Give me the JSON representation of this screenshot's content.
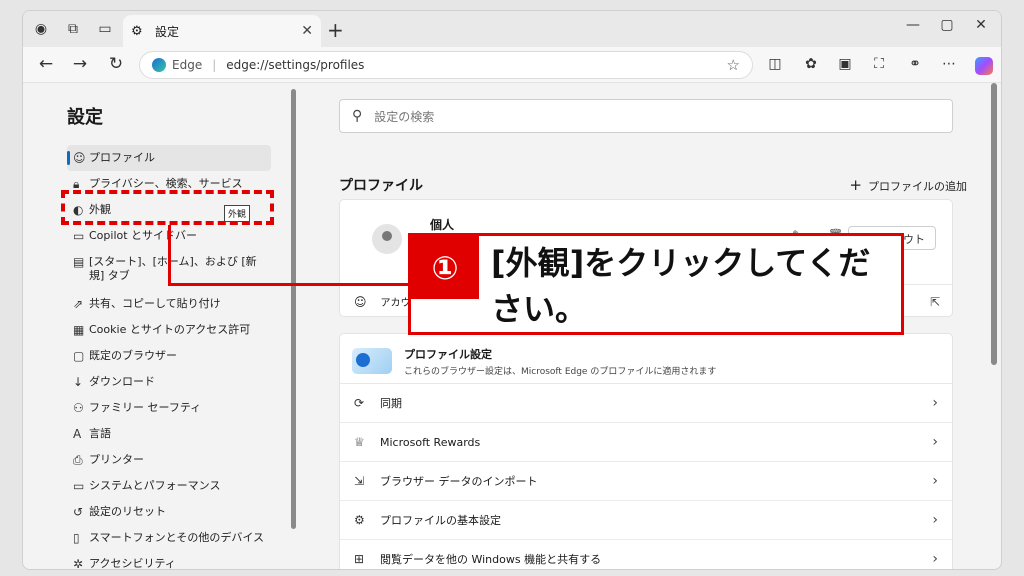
{
  "browser": {
    "tab_title": "設定",
    "address_brand": "Edge",
    "url": "edge://settings/profiles",
    "icons": [
      "profile-icon",
      "workspaces-icon",
      "tab-actions-icon",
      "gear-icon",
      "close-icon",
      "new-tab-icon",
      "back-icon",
      "forward-icon",
      "refresh-icon",
      "star-icon",
      "split-screen-icon",
      "extensions-icon",
      "collections-icon",
      "screenshot-icon",
      "share-icon",
      "more-icon",
      "copilot-icon"
    ]
  },
  "sidebar": {
    "title": "設定",
    "items": [
      {
        "label": "プロファイル",
        "icon": "profile-icon",
        "active": true
      },
      {
        "label": "プライバシー、検索、サービス",
        "icon": "lock-icon"
      },
      {
        "label": "外観",
        "icon": "palette-icon"
      },
      {
        "label": "Copilot とサイドバー",
        "icon": "sidebar-icon"
      },
      {
        "label": "[スタート]、[ホーム]、および [新規] タブ",
        "icon": "home-tab-icon"
      },
      {
        "label": "共有、コピーして貼り付け",
        "icon": "share-icon"
      },
      {
        "label": "Cookie とサイトのアクセス許可",
        "icon": "cookie-icon"
      },
      {
        "label": "既定のブラウザー",
        "icon": "browser-icon"
      },
      {
        "label": "ダウンロード",
        "icon": "download-icon"
      },
      {
        "label": "ファミリー セーフティ",
        "icon": "family-icon"
      },
      {
        "label": "言語",
        "icon": "language-icon"
      },
      {
        "label": "プリンター",
        "icon": "printer-icon"
      },
      {
        "label": "システムとパフォーマンス",
        "icon": "system-icon"
      },
      {
        "label": "設定のリセット",
        "icon": "reset-icon"
      },
      {
        "label": "スマートフォンとその他のデバイス",
        "icon": "phone-icon"
      },
      {
        "label": "アクセシビリティ",
        "icon": "accessibility-icon"
      }
    ],
    "tooltip": "外観"
  },
  "main": {
    "search_placeholder": "設定の検索",
    "section_title": "プロファイル",
    "add_profile_label": "プロファイルの追加",
    "profile": {
      "name": "個人",
      "signout_label": "サインアウト",
      "account_label": "アカウントの管理"
    },
    "banner": {
      "title": "プロファイル設定",
      "desc": "これらのブラウザー設定は、Microsoft Edge のプロファイルに適用されます"
    },
    "rows": [
      {
        "label": "同期",
        "icon": "sync-icon"
      },
      {
        "label": "Microsoft Rewards",
        "icon": "rewards-icon"
      },
      {
        "label": "ブラウザー データのインポート",
        "icon": "import-icon"
      },
      {
        "label": "プロファイルの基本設定",
        "icon": "profile-settings-icon"
      },
      {
        "label": "閲覧データを他の Windows 機能と共有する",
        "icon": "windows-icon"
      }
    ]
  },
  "annotation": {
    "number": "①",
    "text": "[外観]をクリックしてください。",
    "color": "#e00000"
  }
}
